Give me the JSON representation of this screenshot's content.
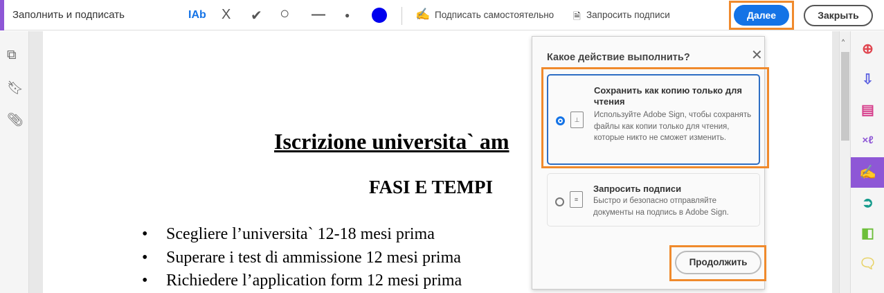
{
  "toolbar": {
    "title": "Заполнить и подписать",
    "tools": {
      "text": "IAb",
      "cross": "X",
      "check": "✔",
      "circle": "○",
      "line": "—",
      "dot": "●"
    },
    "sign_self": "Подписать самостоятельно",
    "request_signatures": "Запросить подписи",
    "next": "Далее",
    "close": "Закрыть",
    "color": "#0000ee"
  },
  "document": {
    "title": "Iscrizione universita` am",
    "subtitle": "FASI E TEMPI",
    "bullets": [
      "Scegliere l’universita` 12-18 mesi prima",
      "Superare i test di ammissione 12 mesi prima",
      "Richiedere l’application form 12 mesi prima"
    ]
  },
  "popup": {
    "question": "Какое действие выполнить?",
    "options": [
      {
        "title": "Сохранить как копию только для чтения",
        "description": "Используйте Adobe Sign, чтобы сохранять файлы как копии только для чтения, которые никто не сможет изменить.",
        "selected": true
      },
      {
        "title": "Запросить подписи",
        "description": "Быстро и безопасно отправляйте документы на подпись в Adobe Sign.",
        "selected": false
      }
    ],
    "continue": "Продолжить"
  }
}
